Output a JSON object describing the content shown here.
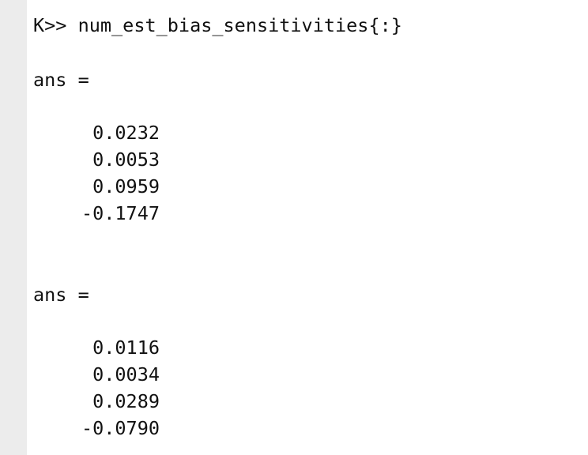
{
  "console": {
    "command_line": "K>> num_est_bias_sensitivities{:}",
    "outputs": [
      {
        "label": "ans =",
        "values": [
          "0.0232",
          "0.0053",
          "0.0959",
          "-0.1747"
        ]
      },
      {
        "label": "ans =",
        "values": [
          "0.0116",
          "0.0034",
          "0.0289",
          "-0.0790"
        ]
      }
    ]
  }
}
